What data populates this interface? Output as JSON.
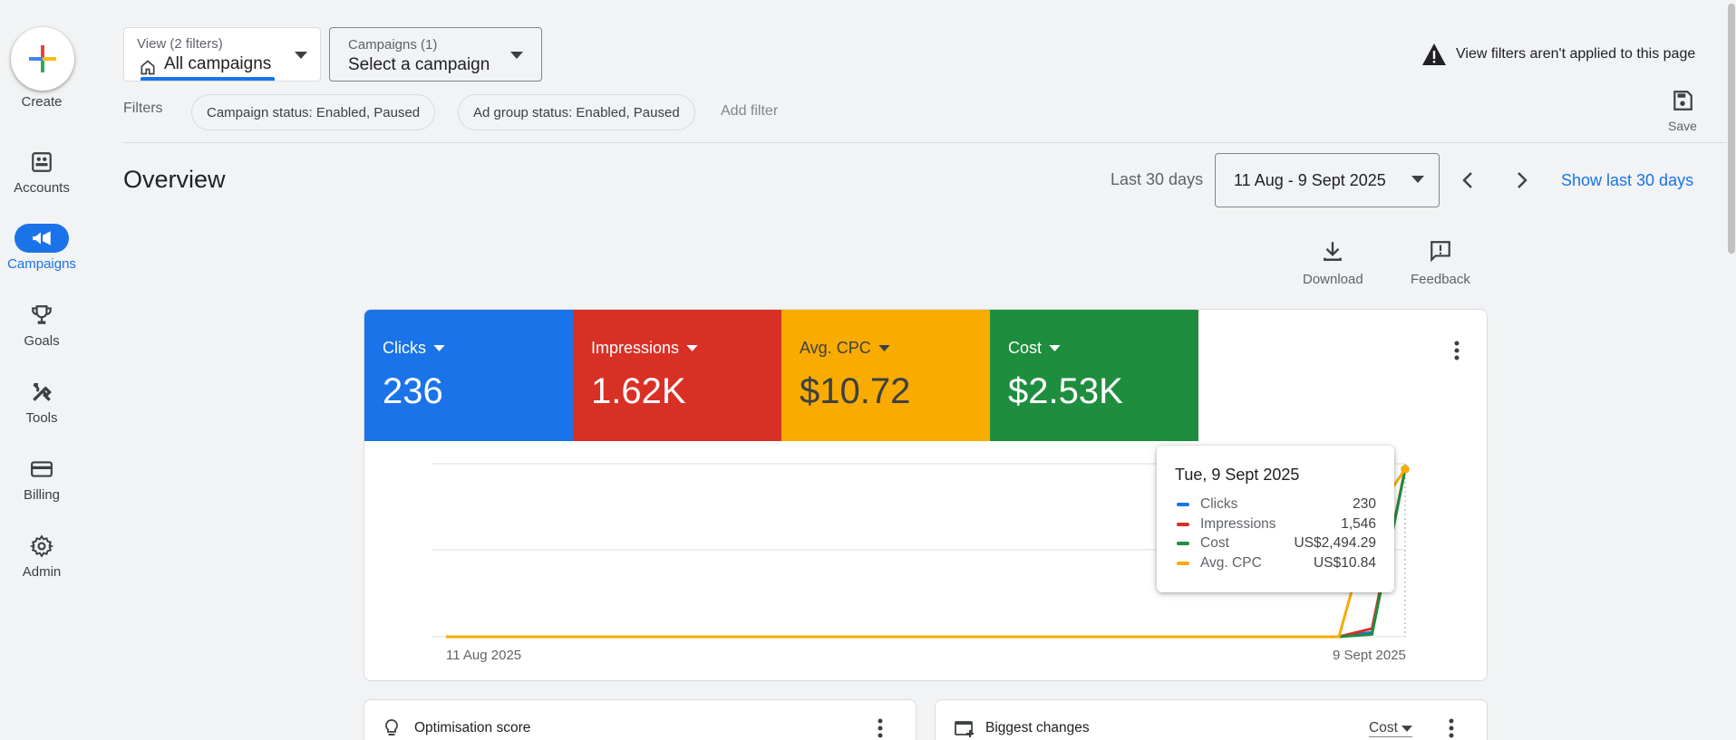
{
  "rail": {
    "create_label": "Create",
    "items": [
      {
        "label": "Accounts",
        "icon": "accounts-icon"
      },
      {
        "label": "Campaigns",
        "icon": "megaphone-icon",
        "active": true
      },
      {
        "label": "Goals",
        "icon": "trophy-icon"
      },
      {
        "label": "Tools",
        "icon": "tools-icon"
      },
      {
        "label": "Billing",
        "icon": "credit-card-icon"
      },
      {
        "label": "Admin",
        "icon": "gear-icon"
      }
    ]
  },
  "view_selector": {
    "caption": "View (2 filters)",
    "value": "All campaigns"
  },
  "campaign_selector": {
    "caption": "Campaigns (1)",
    "value": "Select a campaign"
  },
  "warning": {
    "text": "View filters aren't applied to this page"
  },
  "filters": {
    "label": "Filters",
    "chips": [
      "Campaign status: Enabled, Paused",
      "Ad group status: Enabled, Paused"
    ],
    "add_label": "Add filter"
  },
  "save_label": "Save",
  "page_title": "Overview",
  "date_range": {
    "preset_label": "Last 30 days",
    "value": "11 Aug - 9 Sept 2025",
    "show_last_label": "Show last 30 days"
  },
  "toolbar": {
    "download_label": "Download",
    "feedback_label": "Feedback"
  },
  "metrics": [
    {
      "label": "Clicks",
      "value": "236",
      "color": "#1a73e8"
    },
    {
      "label": "Impressions",
      "value": "1.62K",
      "color": "#d93025"
    },
    {
      "label": "Avg. CPC",
      "value": "$10.72",
      "color": "#f9ab00"
    },
    {
      "label": "Cost",
      "value": "$2.53K",
      "color": "#1e8e3e"
    }
  ],
  "chart_data": {
    "type": "line",
    "x_start_label": "11 Aug 2025",
    "x_end_label": "9 Sept 2025",
    "points_per_series": 30,
    "series": [
      {
        "name": "Clicks",
        "color": "#1a73e8",
        "last_values": [
          0,
          6,
          230
        ]
      },
      {
        "name": "Impressions",
        "color": "#d93025",
        "last_values": [
          0,
          76,
          1546
        ]
      },
      {
        "name": "Cost",
        "color": "#1e8e3e",
        "last_values": [
          0,
          36,
          2494.29
        ]
      },
      {
        "name": "Avg. CPC",
        "color": "#f9ab00",
        "last_values": [
          0,
          7.71,
          10.84
        ]
      }
    ],
    "grid": true
  },
  "tooltip": {
    "title": "Tue, 9 Sept 2025",
    "rows": [
      {
        "name": "Clicks",
        "value": "230",
        "color": "#1a73e8"
      },
      {
        "name": "Impressions",
        "value": "1,546",
        "color": "#d93025"
      },
      {
        "name": "Cost",
        "value": "US$2,494.29",
        "color": "#1e8e3e"
      },
      {
        "name": "Avg. CPC",
        "value": "US$10.84",
        "color": "#f9ab00"
      }
    ]
  },
  "bottom_cards": {
    "optimisation_title": "Optimisation score",
    "biggest_changes_title": "Biggest changes",
    "biggest_changes_metric": "Cost"
  }
}
